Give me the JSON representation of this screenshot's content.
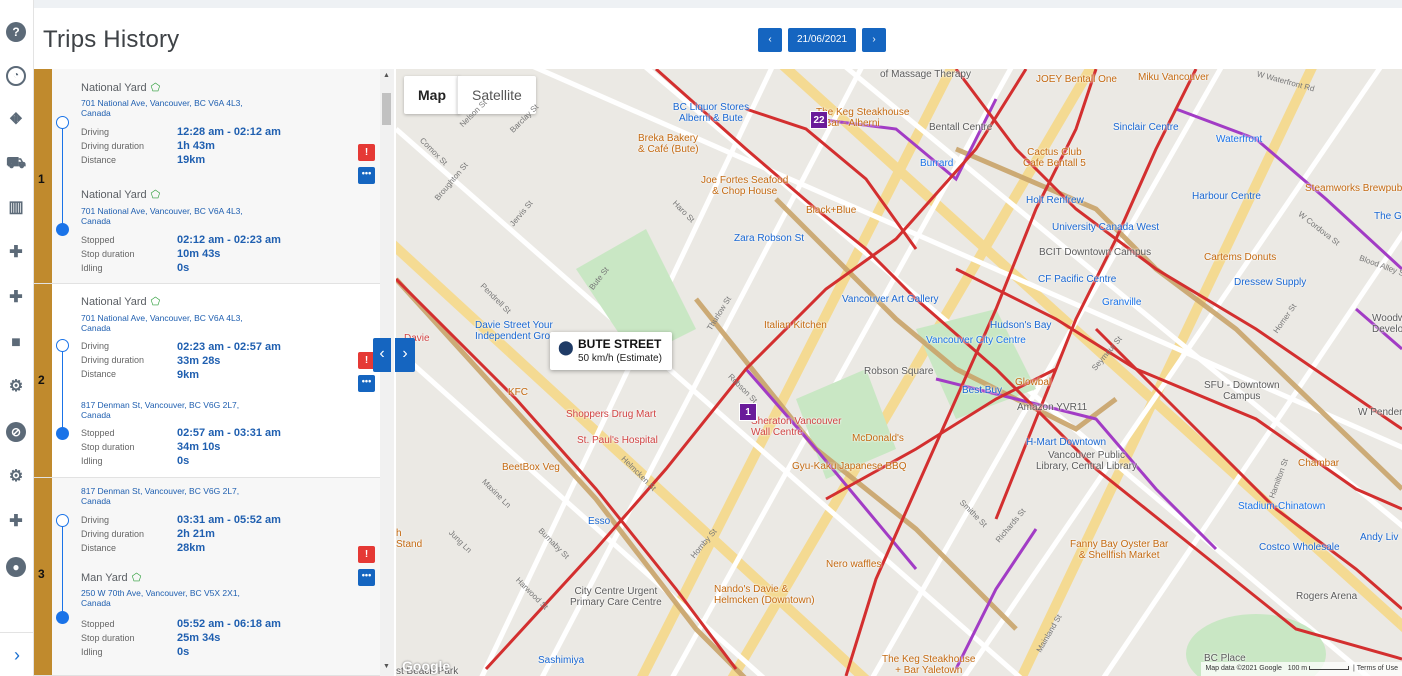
{
  "page": {
    "title": "Trips History"
  },
  "date_nav": {
    "date": "21/06/2021",
    "prev_icon": "‹",
    "next_icon": "›"
  },
  "rail": {
    "icons": [
      "help-icon",
      "dashboard-icon",
      "routes-icon",
      "truck-icon",
      "reports-icon",
      "plugin-icon",
      "plugin-icon-2",
      "camera-icon",
      "settings-icon",
      "compass-icon",
      "gear-icon",
      "plugin-icon-3",
      "location-icon"
    ],
    "expand_icon": "›"
  },
  "trips": [
    {
      "number": "1",
      "start": {
        "yard": "National Yard",
        "address": "701 National Ave, Vancouver, BC V6A 4L3, Canada"
      },
      "driving": {
        "label": "Driving",
        "value": "12:28 am - 02:12 am"
      },
      "driving_duration": {
        "label": "Driving duration",
        "value": "1h 43m"
      },
      "distance": {
        "label": "Distance",
        "value": "19km"
      },
      "end": {
        "yard": "National Yard",
        "address": "701 National Ave, Vancouver, BC V6A 4L3, Canada"
      },
      "stopped": {
        "label": "Stopped",
        "value": "02:12 am - 02:23 am"
      },
      "stop_duration": {
        "label": "Stop duration",
        "value": "10m 43s"
      },
      "idling": {
        "label": "Idling",
        "value": "0s"
      }
    },
    {
      "number": "2",
      "start": {
        "yard": "National Yard",
        "address": "701 National Ave, Vancouver, BC V6A 4L3, Canada"
      },
      "driving": {
        "label": "Driving",
        "value": "02:23 am - 02:57 am"
      },
      "driving_duration": {
        "label": "Driving duration",
        "value": "33m 28s"
      },
      "distance": {
        "label": "Distance",
        "value": "9km"
      },
      "end": {
        "yard": "",
        "address": "817 Denman St, Vancouver, BC V6G 2L7, Canada"
      },
      "stopped": {
        "label": "Stopped",
        "value": "02:57 am - 03:31 am"
      },
      "stop_duration": {
        "label": "Stop duration",
        "value": "34m 10s"
      },
      "idling": {
        "label": "Idling",
        "value": "0s"
      }
    },
    {
      "number": "3",
      "start": {
        "yard": "",
        "address": "817 Denman St, Vancouver, BC V6G 2L7, Canada"
      },
      "driving": {
        "label": "Driving",
        "value": "03:31 am - 05:52 am"
      },
      "driving_duration": {
        "label": "Driving duration",
        "value": "2h 21m"
      },
      "distance": {
        "label": "Distance",
        "value": "28km"
      },
      "end": {
        "yard": "Man Yard",
        "address": "250 W 70th Ave, Vancouver, BC V5X 2X1, Canada"
      },
      "stopped": {
        "label": "Stopped",
        "value": "05:52 am - 06:18 am"
      },
      "stop_duration": {
        "label": "Stop duration",
        "value": "25m 34s"
      },
      "idling": {
        "label": "Idling",
        "value": "0s"
      }
    }
  ],
  "map": {
    "type_buttons": {
      "map": "Map",
      "satellite": "Satellite"
    },
    "tooltip": {
      "title": "BUTE STREET",
      "speed": "50 km/h (Estimate)"
    },
    "markers": {
      "start": "1",
      "end": "22"
    },
    "pois": [
      {
        "name": "BC Liquor Stores\nAlberni & Bute",
        "kind": "shop"
      },
      {
        "name": "The Keg Steakhouse\n+ Bar - Alberni",
        "kind": "food"
      },
      {
        "name": "Breka Bakery\n& Café (Bute)",
        "kind": "food"
      },
      {
        "name": "Joe Fortes Seafood\n& Chop House",
        "kind": "food"
      },
      {
        "name": "Black+Blue",
        "kind": "food"
      },
      {
        "name": "Zara Robson St",
        "kind": "shop"
      },
      {
        "name": "Bentall Centre",
        "kind": "gen"
      },
      {
        "name": "Burrard",
        "kind": "transit"
      },
      {
        "name": "Cactus Club\nCafe Bentall 5",
        "kind": "food"
      },
      {
        "name": "Holt Renfrew",
        "kind": "shop"
      },
      {
        "name": "University Canada West",
        "kind": "shop"
      },
      {
        "name": "BCIT Downtown Campus",
        "kind": "gen"
      },
      {
        "name": "CF Pacific Centre",
        "kind": "shop"
      },
      {
        "name": "Granville",
        "kind": "transit"
      },
      {
        "name": "Vancouver Art Gallery",
        "kind": "shop"
      },
      {
        "name": "Italian Kitchen",
        "kind": "food"
      },
      {
        "name": "Hudson's Bay",
        "kind": "shop"
      },
      {
        "name": "Vancouver City Centre",
        "kind": "transit"
      },
      {
        "name": "Robson Square",
        "kind": "gen"
      },
      {
        "name": "Best Buy",
        "kind": "shop"
      },
      {
        "name": "Amazon YVR11",
        "kind": "gen"
      },
      {
        "name": "Glowbal",
        "kind": "food"
      },
      {
        "name": "Davie Street Your\nIndependent Grocer",
        "kind": "shop"
      },
      {
        "name": "Shoppers Drug Mart",
        "kind": "health"
      },
      {
        "name": "St. Paul's Hospital",
        "kind": "health"
      },
      {
        "name": "Sheraton Vancouver\nWall Centre",
        "kind": "health"
      },
      {
        "name": "McDonald's",
        "kind": "food"
      },
      {
        "name": "Gyu-Kaku Japanese BBQ",
        "kind": "food"
      },
      {
        "name": "BeetBox Veg",
        "kind": "food"
      },
      {
        "name": "Esso",
        "kind": "shop"
      },
      {
        "name": "H-Mart Downtown",
        "kind": "shop"
      },
      {
        "name": "Vancouver Public\nLibrary, Central Library",
        "kind": "gen"
      },
      {
        "name": "Fanny Bay Oyster Bar\n& Shellfish Market",
        "kind": "food"
      },
      {
        "name": "Nero waffles",
        "kind": "food"
      },
      {
        "name": "City Centre Urgent\nPrimary Care Centre",
        "kind": "gen"
      },
      {
        "name": "Nando's Davie &\nHelmcken (Downtown)",
        "kind": "food"
      },
      {
        "name": "Sashimiya",
        "kind": "shop"
      },
      {
        "name": "The Keg Steakhouse\n+ Bar Yaletown",
        "kind": "food"
      },
      {
        "name": "BC Place",
        "kind": "gen"
      },
      {
        "name": "Rogers Arena",
        "kind": "gen"
      },
      {
        "name": "Costco Wholesale",
        "kind": "shop"
      },
      {
        "name": "Stadium-Chinatown",
        "kind": "transit"
      },
      {
        "name": "Chambar",
        "kind": "food"
      },
      {
        "name": "Andy Liv",
        "kind": "shop"
      },
      {
        "name": "SFU - Downtown\nCampus",
        "kind": "gen"
      },
      {
        "name": "Harbour Centre",
        "kind": "shop"
      },
      {
        "name": "Dressew Supply",
        "kind": "shop"
      },
      {
        "name": "Cartems Donuts",
        "kind": "food"
      },
      {
        "name": "Steamworks Brewpub",
        "kind": "food"
      },
      {
        "name": "Waterfront",
        "kind": "transit"
      },
      {
        "name": "Sinclair Centre",
        "kind": "shop"
      },
      {
        "name": "Miku Vancouver",
        "kind": "food"
      },
      {
        "name": "of Massage Therapy",
        "kind": "gen"
      },
      {
        "name": "JOEY Bentall One",
        "kind": "food"
      },
      {
        "name": "The Ga",
        "kind": "shop"
      },
      {
        "name": "Woodw\nDevelo",
        "kind": "gen"
      },
      {
        "name": "W Pender",
        "kind": "gen"
      }
    ],
    "streets": [
      "Nelson St",
      "Barclay St",
      "Bute St",
      "Thurlow St",
      "Hornby St",
      "Seymour St",
      "Richards St",
      "Smithe St",
      "Robson St",
      "W Cordova St",
      "Homer St",
      "Jervis St",
      "Broughton St",
      "Pendrell St",
      "Haro St",
      "Burnaby St",
      "Harwood St",
      "Jung Ln",
      "Maxine Ln",
      "Comox St",
      "Helmcken St",
      "Hamilton St",
      "Mainland St",
      "Blood Alley Sq",
      "W Waterfront Rd"
    ],
    "footer": {
      "data": "Map data ©2021 Google",
      "scale": "100 m",
      "terms": "Terms of Use"
    },
    "logo": "Google",
    "fragments": {
      "davie": "Davie",
      "stand": "h\nStand",
      "beach_park": "st Beach Park",
      "kfc": "KFC",
      "st_cut": "St"
    }
  },
  "colors": {
    "accent": "#1565c0",
    "trip_bar": "#c08a2d",
    "route_red": "#d32f2f",
    "route_purple": "#9c27b0",
    "route_tan": "#c9a46a",
    "marker": "#6a1b9a"
  }
}
